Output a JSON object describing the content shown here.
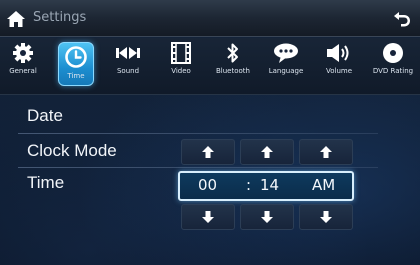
{
  "header": {
    "title": "Settings"
  },
  "nav": {
    "items": [
      {
        "label": "General",
        "icon": "gear-icon",
        "active": false
      },
      {
        "label": "Time",
        "icon": "clock-icon",
        "active": true
      },
      {
        "label": "Sound",
        "icon": "sound-icon",
        "active": false
      },
      {
        "label": "Video",
        "icon": "film-icon",
        "active": false
      },
      {
        "label": "Bluetooth",
        "icon": "bluetooth-icon",
        "active": false
      },
      {
        "label": "Language",
        "icon": "speech-bubble-icon",
        "active": false
      },
      {
        "label": "Volume",
        "icon": "speaker-icon",
        "active": false
      },
      {
        "label": "DVD Rating",
        "icon": "disc-icon",
        "active": false
      }
    ]
  },
  "settings": {
    "date_label": "Date",
    "clock_mode_label": "Clock Mode",
    "time_label": "Time"
  },
  "time": {
    "hours": "00",
    "separator": ":",
    "minutes": "14",
    "period": "AM"
  },
  "colors": {
    "accent": "#1c8ed0",
    "field_border": "#d8eefc",
    "text": "#f2f5f9"
  }
}
